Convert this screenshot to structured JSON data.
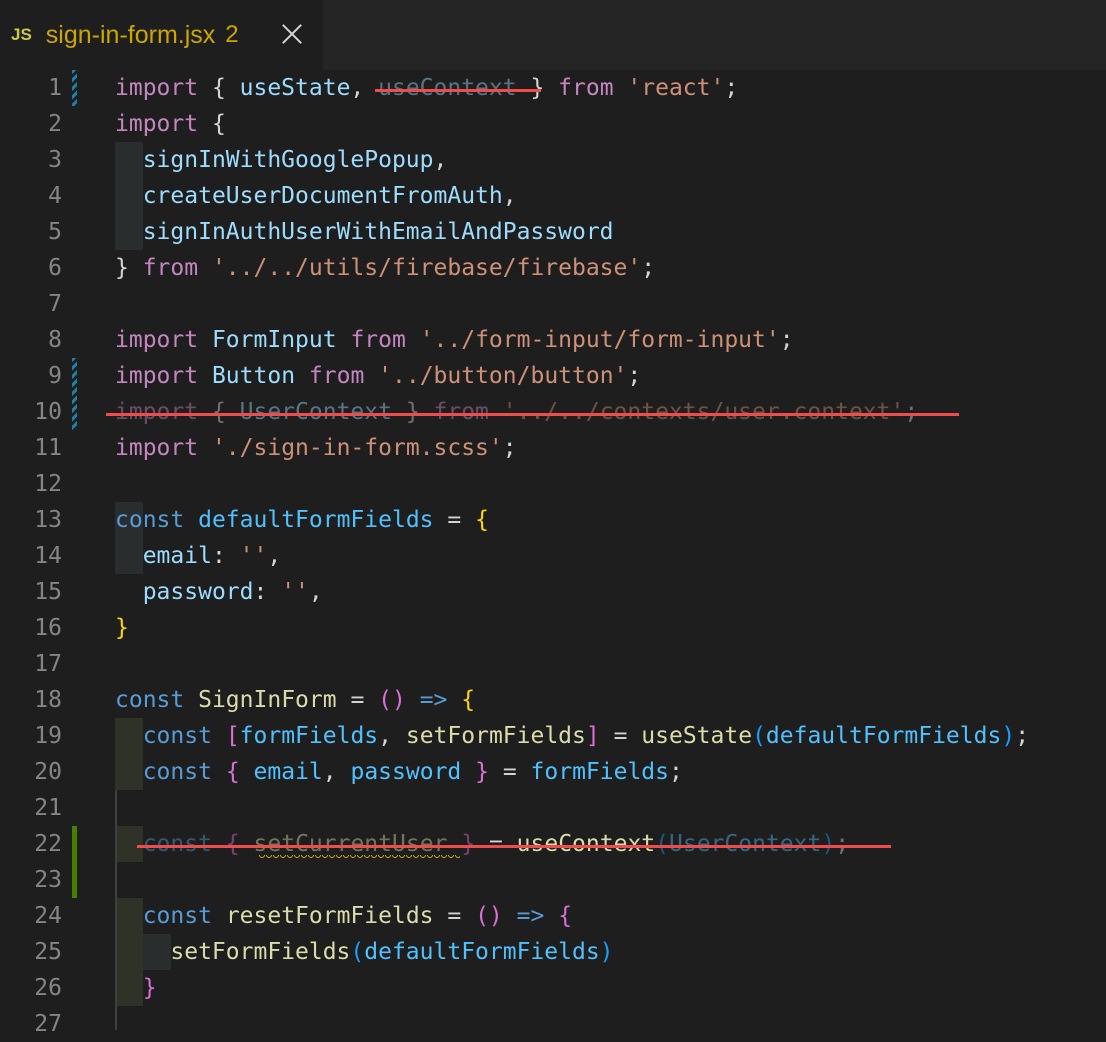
{
  "tab": {
    "icon_text": "JS",
    "filename": "sign-in-form.jsx",
    "problem_count": "2",
    "close_icon": "close-icon"
  },
  "lines": [
    {
      "n": "1",
      "tokens": [
        [
          "k",
          "import"
        ],
        [
          "o",
          " { "
        ],
        [
          "v",
          "useState"
        ],
        [
          "o",
          ", "
        ],
        [
          "v dim",
          "useContext"
        ],
        [
          "o",
          " } "
        ],
        [
          "k",
          "from"
        ],
        [
          "o",
          " "
        ],
        [
          "s",
          "'react'"
        ],
        [
          "o",
          ";"
        ]
      ]
    },
    {
      "n": "2",
      "tokens": [
        [
          "k",
          "import"
        ],
        [
          "o",
          " {"
        ]
      ]
    },
    {
      "n": "3",
      "tokens": [
        [
          "o",
          "  "
        ],
        [
          "v",
          "signInWithGooglePopup"
        ],
        [
          "o",
          ","
        ]
      ]
    },
    {
      "n": "4",
      "tokens": [
        [
          "o",
          "  "
        ],
        [
          "v",
          "createUserDocumentFromAuth"
        ],
        [
          "o",
          ","
        ]
      ]
    },
    {
      "n": "5",
      "tokens": [
        [
          "o",
          "  "
        ],
        [
          "v",
          "signInAuthUserWithEmailAndPassword"
        ]
      ]
    },
    {
      "n": "6",
      "tokens": [
        [
          "o",
          "} "
        ],
        [
          "k",
          "from"
        ],
        [
          "o",
          " "
        ],
        [
          "s",
          "'../../utils/firebase/firebase'"
        ],
        [
          "o",
          ";"
        ]
      ]
    },
    {
      "n": "7",
      "tokens": []
    },
    {
      "n": "8",
      "tokens": [
        [
          "k",
          "import"
        ],
        [
          "o",
          " "
        ],
        [
          "v",
          "FormInput"
        ],
        [
          "o",
          " "
        ],
        [
          "k",
          "from"
        ],
        [
          "o",
          " "
        ],
        [
          "s",
          "'../form-input/form-input'"
        ],
        [
          "o",
          ";"
        ]
      ]
    },
    {
      "n": "9",
      "tokens": [
        [
          "k",
          "import"
        ],
        [
          "o",
          " "
        ],
        [
          "v",
          "Button"
        ],
        [
          "o",
          " "
        ],
        [
          "k",
          "from"
        ],
        [
          "o",
          " "
        ],
        [
          "s",
          "'../button/button'"
        ],
        [
          "o",
          ";"
        ]
      ]
    },
    {
      "n": "10",
      "tokens": [
        [
          "k dim",
          "import"
        ],
        [
          "o dim",
          " { "
        ],
        [
          "v dim",
          "UserContext"
        ],
        [
          "o dim",
          " } "
        ],
        [
          "k dim",
          "from"
        ],
        [
          "o dim",
          " "
        ],
        [
          "s dim",
          "'../../contexts/user.context'"
        ],
        [
          "o dim",
          ";"
        ]
      ]
    },
    {
      "n": "11",
      "tokens": [
        [
          "k",
          "import"
        ],
        [
          "o",
          " "
        ],
        [
          "s",
          "'./sign-in-form.scss'"
        ],
        [
          "o",
          ";"
        ]
      ]
    },
    {
      "n": "12",
      "tokens": []
    },
    {
      "n": "13",
      "tokens": [
        [
          "b",
          "const"
        ],
        [
          "o",
          " "
        ],
        [
          "c",
          "defaultFormFields"
        ],
        [
          "o",
          " = "
        ],
        [
          "p",
          "{"
        ]
      ]
    },
    {
      "n": "14",
      "tokens": [
        [
          "o",
          "  "
        ],
        [
          "v",
          "email"
        ],
        [
          "o",
          ": "
        ],
        [
          "s",
          "''"
        ],
        [
          "o",
          ","
        ]
      ]
    },
    {
      "n": "15",
      "tokens": [
        [
          "o",
          "  "
        ],
        [
          "v",
          "password"
        ],
        [
          "o",
          ": "
        ],
        [
          "s",
          "''"
        ],
        [
          "o",
          ","
        ]
      ]
    },
    {
      "n": "16",
      "tokens": [
        [
          "p",
          "}"
        ]
      ]
    },
    {
      "n": "17",
      "tokens": []
    },
    {
      "n": "18",
      "tokens": [
        [
          "b",
          "const"
        ],
        [
          "o",
          " "
        ],
        [
          "f",
          "SignInForm"
        ],
        [
          "o",
          " = "
        ],
        [
          "q",
          "()"
        ],
        [
          "o",
          " "
        ],
        [
          "b",
          "=>"
        ],
        [
          "o",
          " "
        ],
        [
          "p",
          "{"
        ]
      ]
    },
    {
      "n": "19",
      "tokens": [
        [
          "o",
          "  "
        ],
        [
          "b",
          "const"
        ],
        [
          "o",
          " "
        ],
        [
          "q",
          "["
        ],
        [
          "c",
          "formFields"
        ],
        [
          "o",
          ", "
        ],
        [
          "f",
          "setFormFields"
        ],
        [
          "q",
          "]"
        ],
        [
          "o",
          " = "
        ],
        [
          "f",
          "useState"
        ],
        [
          "p3",
          "("
        ],
        [
          "c",
          "defaultFormFields"
        ],
        [
          "p3",
          ")"
        ],
        [
          "o",
          ";"
        ]
      ]
    },
    {
      "n": "20",
      "tokens": [
        [
          "o",
          "  "
        ],
        [
          "b",
          "const"
        ],
        [
          "o",
          " "
        ],
        [
          "q",
          "{"
        ],
        [
          "o",
          " "
        ],
        [
          "c",
          "email"
        ],
        [
          "o",
          ", "
        ],
        [
          "c",
          "password"
        ],
        [
          "o",
          " "
        ],
        [
          "q",
          "}"
        ],
        [
          "o",
          " = "
        ],
        [
          "c",
          "formFields"
        ],
        [
          "o",
          ";"
        ]
      ]
    },
    {
      "n": "21",
      "tokens": []
    },
    {
      "n": "22",
      "tokens": [
        [
          "o",
          "  "
        ],
        [
          "b dim",
          "const"
        ],
        [
          "o dim",
          " "
        ],
        [
          "q dim",
          "{"
        ],
        [
          "o dim",
          " "
        ],
        [
          "f dim",
          "setCurrentUser"
        ],
        [
          "o dim",
          " "
        ],
        [
          "q dim",
          "}"
        ],
        [
          "o",
          " = "
        ],
        [
          "f",
          "useContext"
        ],
        [
          "p3 dim",
          "("
        ],
        [
          "c dim",
          "UserContext"
        ],
        [
          "p3 dim",
          ")"
        ],
        [
          "o dim",
          ";"
        ]
      ]
    },
    {
      "n": "23",
      "tokens": []
    },
    {
      "n": "24",
      "tokens": [
        [
          "o",
          "  "
        ],
        [
          "b",
          "const"
        ],
        [
          "o",
          " "
        ],
        [
          "f",
          "resetFormFields"
        ],
        [
          "o",
          " = "
        ],
        [
          "q",
          "()"
        ],
        [
          "o",
          " "
        ],
        [
          "b",
          "=>"
        ],
        [
          "o",
          " "
        ],
        [
          "q",
          "{"
        ]
      ]
    },
    {
      "n": "25",
      "tokens": [
        [
          "o",
          "    "
        ],
        [
          "f",
          "setFormFields"
        ],
        [
          "p3",
          "("
        ],
        [
          "c",
          "defaultFormFields"
        ],
        [
          "p3",
          ")"
        ]
      ]
    },
    {
      "n": "26",
      "tokens": [
        [
          "o",
          "  "
        ],
        [
          "q",
          "}"
        ]
      ]
    },
    {
      "n": "27",
      "tokens": []
    }
  ]
}
